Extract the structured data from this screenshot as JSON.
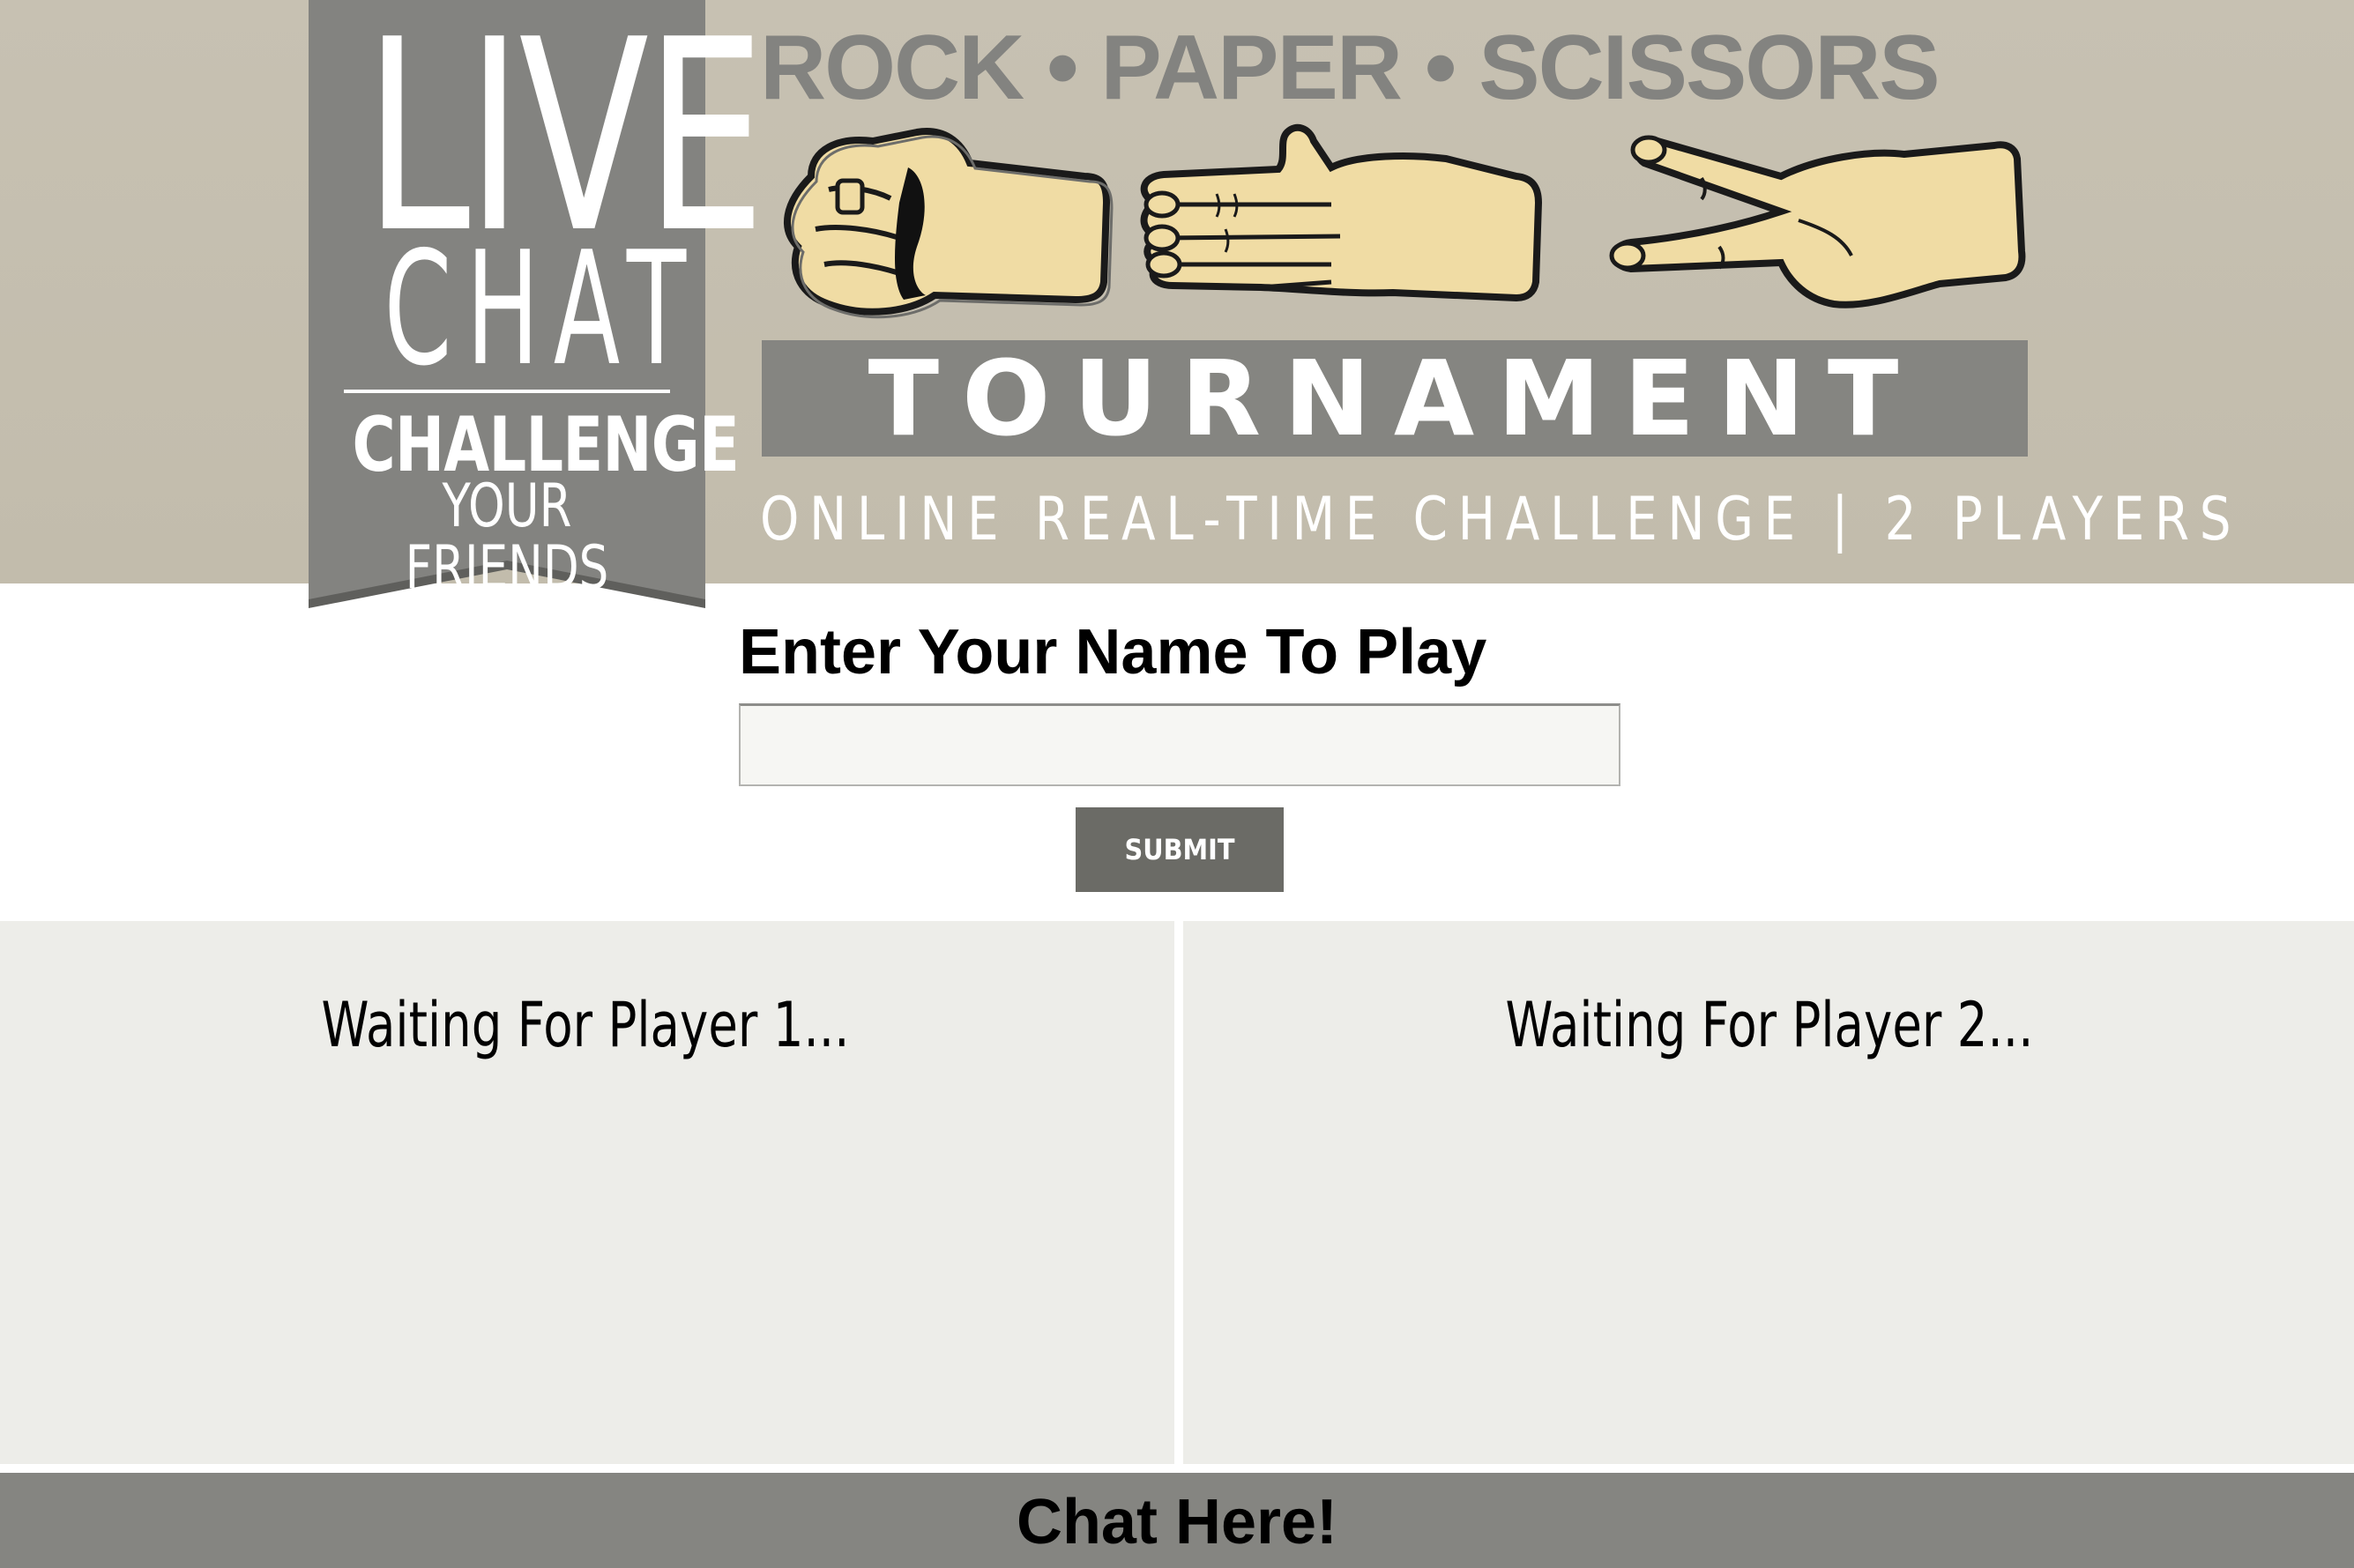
{
  "banner": {
    "ribbon": {
      "line1": "LIVE",
      "line2": "CHAT",
      "line3": "CHALLENGE",
      "line4": "YOUR FRIENDS"
    },
    "title": "ROCK • PAPER • SCISSORS",
    "hands": [
      "rock-hand-icon",
      "paper-hand-icon",
      "scissors-hand-icon"
    ],
    "tournament": "TOURNAMENT",
    "tagline": "ONLINE REAL-TIME CHALLENGE | 2 PLAYERS"
  },
  "name_form": {
    "heading": "Enter Your Name To Play",
    "input_value": "",
    "input_placeholder": "",
    "submit_label": "SUBMIT"
  },
  "players": {
    "player1_status": "Waiting For Player 1...",
    "player2_status": "Waiting For Player 2..."
  },
  "chat": {
    "label": "Chat Here!"
  },
  "colors": {
    "banner_bg": "#c7c1b2",
    "ribbon_gray": "#838380",
    "bar_gray": "#858581",
    "button_gray": "#6b6b66",
    "panel_bg": "#edede9",
    "hand_skin": "#f0dca4"
  }
}
